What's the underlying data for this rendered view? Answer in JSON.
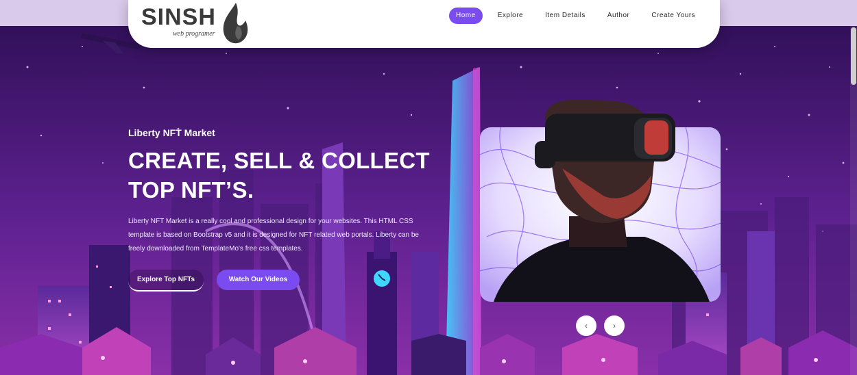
{
  "brand": {
    "name": "SINSH",
    "tagline": "web programer"
  },
  "nav": {
    "items": [
      {
        "label": "Home",
        "active": true
      },
      {
        "label": "Explore",
        "active": false
      },
      {
        "label": "Item Details",
        "active": false
      },
      {
        "label": "Author",
        "active": false
      },
      {
        "label": "Create Yours",
        "active": false
      }
    ]
  },
  "hero": {
    "subtitle": "Liberty NFT Market",
    "headline_line1": "CREATE, SELL & COLLECT",
    "headline_line2": "TOP NFT’S.",
    "description": "Liberty NFT Market is a really cool and professional design for your websites. This HTML CSS template is based on Bootstrap v5 and it is designed for NFT related web portals. Liberty can be freely downloaded from TemplateMo's free css templates.",
    "btn_explore": "Explore Top NFTs",
    "btn_watch": "Watch Our Videos"
  },
  "carousel": {
    "prev": "‹",
    "next": "›"
  },
  "colors": {
    "accent": "#7a4cf0",
    "header_bg": "#ffffff",
    "scene_bg": "#5a1f86"
  }
}
